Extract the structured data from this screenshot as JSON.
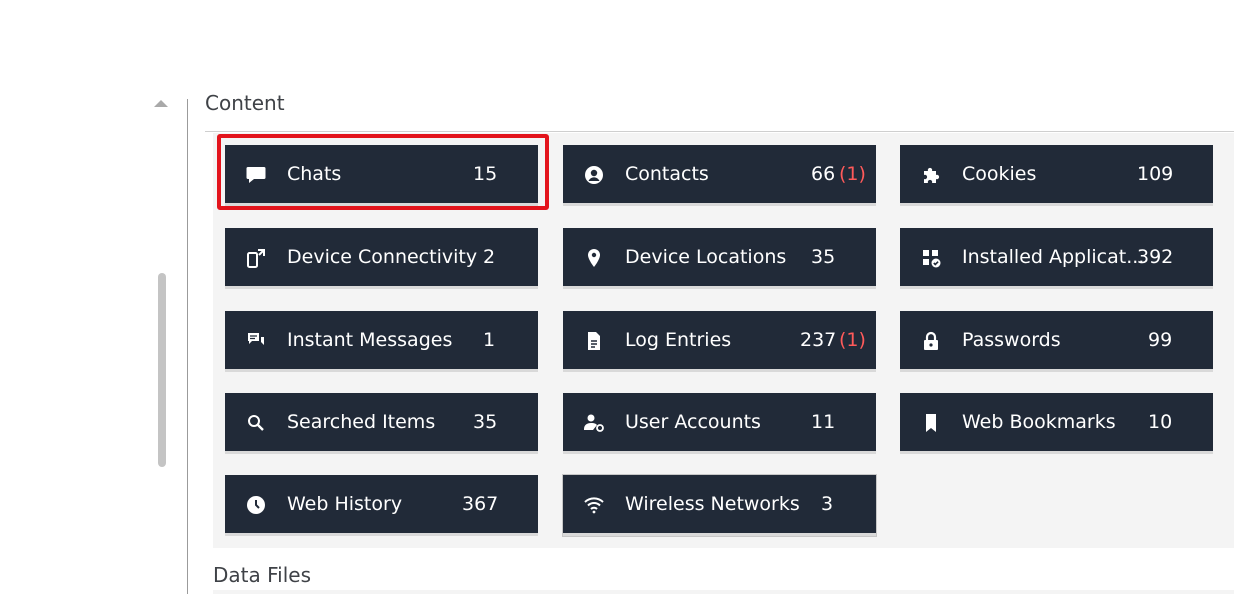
{
  "section": {
    "title": "Content"
  },
  "tiles": [
    {
      "label": "Chats",
      "count": "15",
      "flag": "",
      "icon": "chat-bubble-icon"
    },
    {
      "label": "Contacts",
      "count": "66",
      "flag": "(1)",
      "icon": "contact-icon"
    },
    {
      "label": "Cookies",
      "count": "109",
      "flag": "",
      "icon": "cookie-puzzle-icon"
    },
    {
      "label": "Device Connectivity",
      "count": "2",
      "flag": "",
      "icon": "device-connectivity-icon"
    },
    {
      "label": "Device Locations",
      "count": "35",
      "flag": "",
      "icon": "location-pin-icon"
    },
    {
      "label": "Installed Applicat...",
      "count": "392",
      "flag": "",
      "icon": "installed-apps-icon"
    },
    {
      "label": "Instant Messages",
      "count": "1",
      "flag": "",
      "icon": "instant-messages-icon"
    },
    {
      "label": "Log Entries",
      "count": "237",
      "flag": "(1)",
      "icon": "document-icon"
    },
    {
      "label": "Passwords",
      "count": "99",
      "flag": "",
      "icon": "lock-icon"
    },
    {
      "label": "Searched Items",
      "count": "35",
      "flag": "",
      "icon": "search-icon"
    },
    {
      "label": "User Accounts",
      "count": "11",
      "flag": "",
      "icon": "user-accounts-icon"
    },
    {
      "label": "Web Bookmarks",
      "count": "10",
      "flag": "",
      "icon": "bookmark-icon"
    },
    {
      "label": "Web History",
      "count": "367",
      "flag": "",
      "icon": "clock-icon"
    },
    {
      "label": "Wireless Networks",
      "count": "3",
      "flag": "",
      "icon": "wifi-icon"
    }
  ],
  "next_section": {
    "title": "Data Files"
  },
  "colors": {
    "tile_bg": "#212a38",
    "flag_red": "#ff5a5a",
    "selection_red": "#e3141c"
  }
}
